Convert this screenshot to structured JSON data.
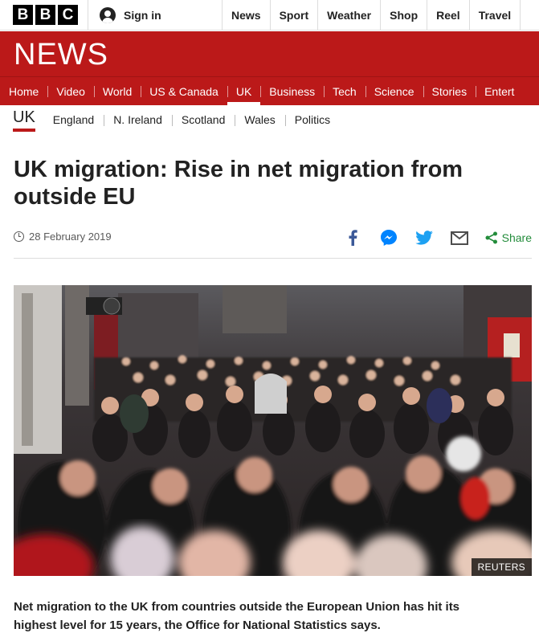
{
  "brand": {
    "letters": [
      "B",
      "B",
      "C"
    ],
    "news_wordmark": "NEWS"
  },
  "account": {
    "signin_label": "Sign in"
  },
  "global_nav": [
    "News",
    "Sport",
    "Weather",
    "Shop",
    "Reel",
    "Travel"
  ],
  "section_nav": {
    "items": [
      "Home",
      "Video",
      "World",
      "US & Canada",
      "UK",
      "Business",
      "Tech",
      "Science",
      "Stories",
      "Entert"
    ],
    "active": "UK"
  },
  "sub_nav": {
    "current": "UK",
    "items": [
      "England",
      "N. Ireland",
      "Scotland",
      "Wales",
      "Politics"
    ]
  },
  "article": {
    "title": "UK migration: Rise in net migration from outside EU",
    "date": "28 February 2019",
    "share_label": "Share",
    "image_credit": "REUTERS",
    "intro": "Net migration to the UK from countries outside the European Union has hit its highest level for 15 years, the Office for National Statistics says."
  },
  "share_icons": [
    "facebook-icon",
    "messenger-icon",
    "twitter-icon",
    "email-icon",
    "share-icon"
  ],
  "colors": {
    "brand_red": "#bb1919",
    "facebook": "#3b5998",
    "messenger": "#0084ff",
    "twitter": "#1da1f2",
    "share_green": "#238c3b"
  }
}
